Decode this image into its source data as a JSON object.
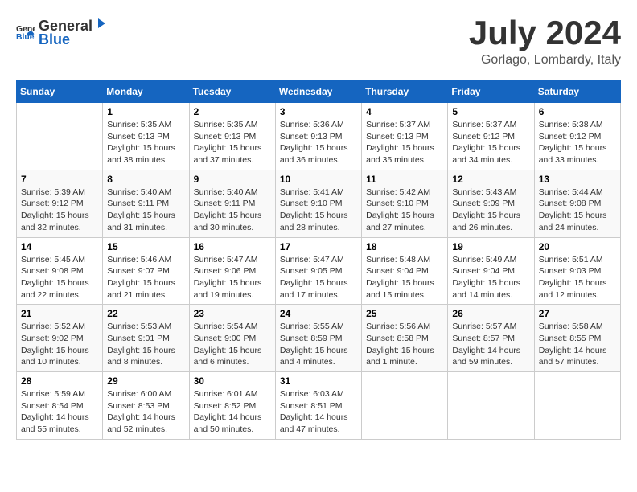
{
  "header": {
    "logo": {
      "general": "General",
      "blue": "Blue"
    },
    "title": "July 2024",
    "location": "Gorlago, Lombardy, Italy"
  },
  "calendar": {
    "headers": [
      "Sunday",
      "Monday",
      "Tuesday",
      "Wednesday",
      "Thursday",
      "Friday",
      "Saturday"
    ],
    "weeks": [
      [
        {
          "day": "",
          "sunrise": "",
          "sunset": "",
          "daylight": ""
        },
        {
          "day": "1",
          "sunrise": "Sunrise: 5:35 AM",
          "sunset": "Sunset: 9:13 PM",
          "daylight": "Daylight: 15 hours and 38 minutes."
        },
        {
          "day": "2",
          "sunrise": "Sunrise: 5:35 AM",
          "sunset": "Sunset: 9:13 PM",
          "daylight": "Daylight: 15 hours and 37 minutes."
        },
        {
          "day": "3",
          "sunrise": "Sunrise: 5:36 AM",
          "sunset": "Sunset: 9:13 PM",
          "daylight": "Daylight: 15 hours and 36 minutes."
        },
        {
          "day": "4",
          "sunrise": "Sunrise: 5:37 AM",
          "sunset": "Sunset: 9:13 PM",
          "daylight": "Daylight: 15 hours and 35 minutes."
        },
        {
          "day": "5",
          "sunrise": "Sunrise: 5:37 AM",
          "sunset": "Sunset: 9:12 PM",
          "daylight": "Daylight: 15 hours and 34 minutes."
        },
        {
          "day": "6",
          "sunrise": "Sunrise: 5:38 AM",
          "sunset": "Sunset: 9:12 PM",
          "daylight": "Daylight: 15 hours and 33 minutes."
        }
      ],
      [
        {
          "day": "7",
          "sunrise": "Sunrise: 5:39 AM",
          "sunset": "Sunset: 9:12 PM",
          "daylight": "Daylight: 15 hours and 32 minutes."
        },
        {
          "day": "8",
          "sunrise": "Sunrise: 5:40 AM",
          "sunset": "Sunset: 9:11 PM",
          "daylight": "Daylight: 15 hours and 31 minutes."
        },
        {
          "day": "9",
          "sunrise": "Sunrise: 5:40 AM",
          "sunset": "Sunset: 9:11 PM",
          "daylight": "Daylight: 15 hours and 30 minutes."
        },
        {
          "day": "10",
          "sunrise": "Sunrise: 5:41 AM",
          "sunset": "Sunset: 9:10 PM",
          "daylight": "Daylight: 15 hours and 28 minutes."
        },
        {
          "day": "11",
          "sunrise": "Sunrise: 5:42 AM",
          "sunset": "Sunset: 9:10 PM",
          "daylight": "Daylight: 15 hours and 27 minutes."
        },
        {
          "day": "12",
          "sunrise": "Sunrise: 5:43 AM",
          "sunset": "Sunset: 9:09 PM",
          "daylight": "Daylight: 15 hours and 26 minutes."
        },
        {
          "day": "13",
          "sunrise": "Sunrise: 5:44 AM",
          "sunset": "Sunset: 9:08 PM",
          "daylight": "Daylight: 15 hours and 24 minutes."
        }
      ],
      [
        {
          "day": "14",
          "sunrise": "Sunrise: 5:45 AM",
          "sunset": "Sunset: 9:08 PM",
          "daylight": "Daylight: 15 hours and 22 minutes."
        },
        {
          "day": "15",
          "sunrise": "Sunrise: 5:46 AM",
          "sunset": "Sunset: 9:07 PM",
          "daylight": "Daylight: 15 hours and 21 minutes."
        },
        {
          "day": "16",
          "sunrise": "Sunrise: 5:47 AM",
          "sunset": "Sunset: 9:06 PM",
          "daylight": "Daylight: 15 hours and 19 minutes."
        },
        {
          "day": "17",
          "sunrise": "Sunrise: 5:47 AM",
          "sunset": "Sunset: 9:05 PM",
          "daylight": "Daylight: 15 hours and 17 minutes."
        },
        {
          "day": "18",
          "sunrise": "Sunrise: 5:48 AM",
          "sunset": "Sunset: 9:04 PM",
          "daylight": "Daylight: 15 hours and 15 minutes."
        },
        {
          "day": "19",
          "sunrise": "Sunrise: 5:49 AM",
          "sunset": "Sunset: 9:04 PM",
          "daylight": "Daylight: 15 hours and 14 minutes."
        },
        {
          "day": "20",
          "sunrise": "Sunrise: 5:51 AM",
          "sunset": "Sunset: 9:03 PM",
          "daylight": "Daylight: 15 hours and 12 minutes."
        }
      ],
      [
        {
          "day": "21",
          "sunrise": "Sunrise: 5:52 AM",
          "sunset": "Sunset: 9:02 PM",
          "daylight": "Daylight: 15 hours and 10 minutes."
        },
        {
          "day": "22",
          "sunrise": "Sunrise: 5:53 AM",
          "sunset": "Sunset: 9:01 PM",
          "daylight": "Daylight: 15 hours and 8 minutes."
        },
        {
          "day": "23",
          "sunrise": "Sunrise: 5:54 AM",
          "sunset": "Sunset: 9:00 PM",
          "daylight": "Daylight: 15 hours and 6 minutes."
        },
        {
          "day": "24",
          "sunrise": "Sunrise: 5:55 AM",
          "sunset": "Sunset: 8:59 PM",
          "daylight": "Daylight: 15 hours and 4 minutes."
        },
        {
          "day": "25",
          "sunrise": "Sunrise: 5:56 AM",
          "sunset": "Sunset: 8:58 PM",
          "daylight": "Daylight: 15 hours and 1 minute."
        },
        {
          "day": "26",
          "sunrise": "Sunrise: 5:57 AM",
          "sunset": "Sunset: 8:57 PM",
          "daylight": "Daylight: 14 hours and 59 minutes."
        },
        {
          "day": "27",
          "sunrise": "Sunrise: 5:58 AM",
          "sunset": "Sunset: 8:55 PM",
          "daylight": "Daylight: 14 hours and 57 minutes."
        }
      ],
      [
        {
          "day": "28",
          "sunrise": "Sunrise: 5:59 AM",
          "sunset": "Sunset: 8:54 PM",
          "daylight": "Daylight: 14 hours and 55 minutes."
        },
        {
          "day": "29",
          "sunrise": "Sunrise: 6:00 AM",
          "sunset": "Sunset: 8:53 PM",
          "daylight": "Daylight: 14 hours and 52 minutes."
        },
        {
          "day": "30",
          "sunrise": "Sunrise: 6:01 AM",
          "sunset": "Sunset: 8:52 PM",
          "daylight": "Daylight: 14 hours and 50 minutes."
        },
        {
          "day": "31",
          "sunrise": "Sunrise: 6:03 AM",
          "sunset": "Sunset: 8:51 PM",
          "daylight": "Daylight: 14 hours and 47 minutes."
        },
        {
          "day": "",
          "sunrise": "",
          "sunset": "",
          "daylight": ""
        },
        {
          "day": "",
          "sunrise": "",
          "sunset": "",
          "daylight": ""
        },
        {
          "day": "",
          "sunrise": "",
          "sunset": "",
          "daylight": ""
        }
      ]
    ]
  }
}
